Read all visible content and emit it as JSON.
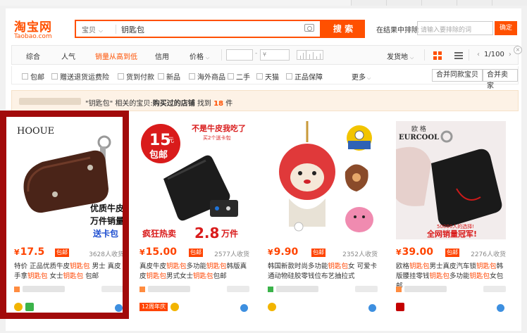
{
  "header": {
    "logo_cn": "淘宝网",
    "logo_en": "Taobao.com",
    "search_category": "宝贝",
    "search_query": "钥匙包",
    "search_button": "搜 索",
    "sub_search_label": "在结果中排除",
    "sub_search_placeholder": "请输入要排除的词",
    "confirm_button": "确定"
  },
  "sortbar": {
    "tabs": [
      "综合",
      "人气",
      "销量从高到低",
      "信用",
      "价格"
    ],
    "price_from": "",
    "price_to": "¥",
    "ship_from": "发货地",
    "page": "1/100"
  },
  "filters": {
    "items": [
      "包邮",
      "赠送退货运费险",
      "货到付款",
      "新品",
      "海外商品",
      "二手",
      "天猫",
      "正品保障"
    ],
    "more": "更多",
    "btn_merge_same": "合并同款宝贝",
    "btn_merge_seller": "合并卖家"
  },
  "notice": {
    "pre": "\"钥匙包\" 相关的宝贝:",
    "bold": "购买过的店铺",
    "mid": "找到",
    "count": "18",
    "post": "件"
  },
  "products": [
    {
      "yen": "¥",
      "price": "17.5",
      "baoyou": "包邮",
      "sales": "3628人收货",
      "title_parts": [
        "特价 正品优质牛皮",
        "钥匙包",
        " 男士 真皮手拿",
        "钥匙包",
        " 女士",
        "钥匙包",
        " 包邮"
      ],
      "img_brand": "HOOUE",
      "img_line1": "优质牛皮",
      "img_line2": "万件销量",
      "img_line3": "送卡包"
    },
    {
      "yen": "¥",
      "price": "15.00",
      "baoyou": "包邮",
      "sales": "2577人收货",
      "title_parts": [
        "真皮牛皮",
        "钥匙包",
        "多功能",
        "钥匙包",
        "韩版真皮",
        "钥匙包",
        "男式女士",
        "钥匙包",
        "包邮"
      ],
      "img_top": "不是牛皮我吃了",
      "img_sub": "买2个送卡包",
      "img_badge_num": "15",
      "img_badge_unit": "元",
      "img_badge_text": "包邮",
      "img_bottom_left": "疯狂热卖",
      "img_bottom_num": "2.8",
      "img_bottom_unit": "万件",
      "anniv": "12周年庆"
    },
    {
      "yen": "¥",
      "price": "9.90",
      "baoyou": "包邮",
      "sales": "2352人收货",
      "title_parts": [
        "韩国新款时尚多功能",
        "钥匙包",
        "女 可爱卡通动物硅胶零钱位布艺抽拉式"
      ]
    },
    {
      "yen": "¥",
      "price": "39.00",
      "baoyou": "包邮",
      "sales": "2276人收货",
      "title_parts": [
        "欧格",
        "钥匙包",
        "男士真皮汽车锁",
        "钥匙包",
        "韩版腰挂零钱",
        "钥匙包",
        "多功能",
        "钥匙包",
        "女包邮"
      ],
      "img_brand_cn": "欧 格",
      "img_brand": "EURCOOL",
      "img_line1": "50000人的选择!",
      "img_line2": "全网销量冠军!"
    }
  ],
  "colors": {
    "accent": "#ff5000",
    "price": "#ff4400",
    "highlight_frame": "#a20a0a"
  }
}
